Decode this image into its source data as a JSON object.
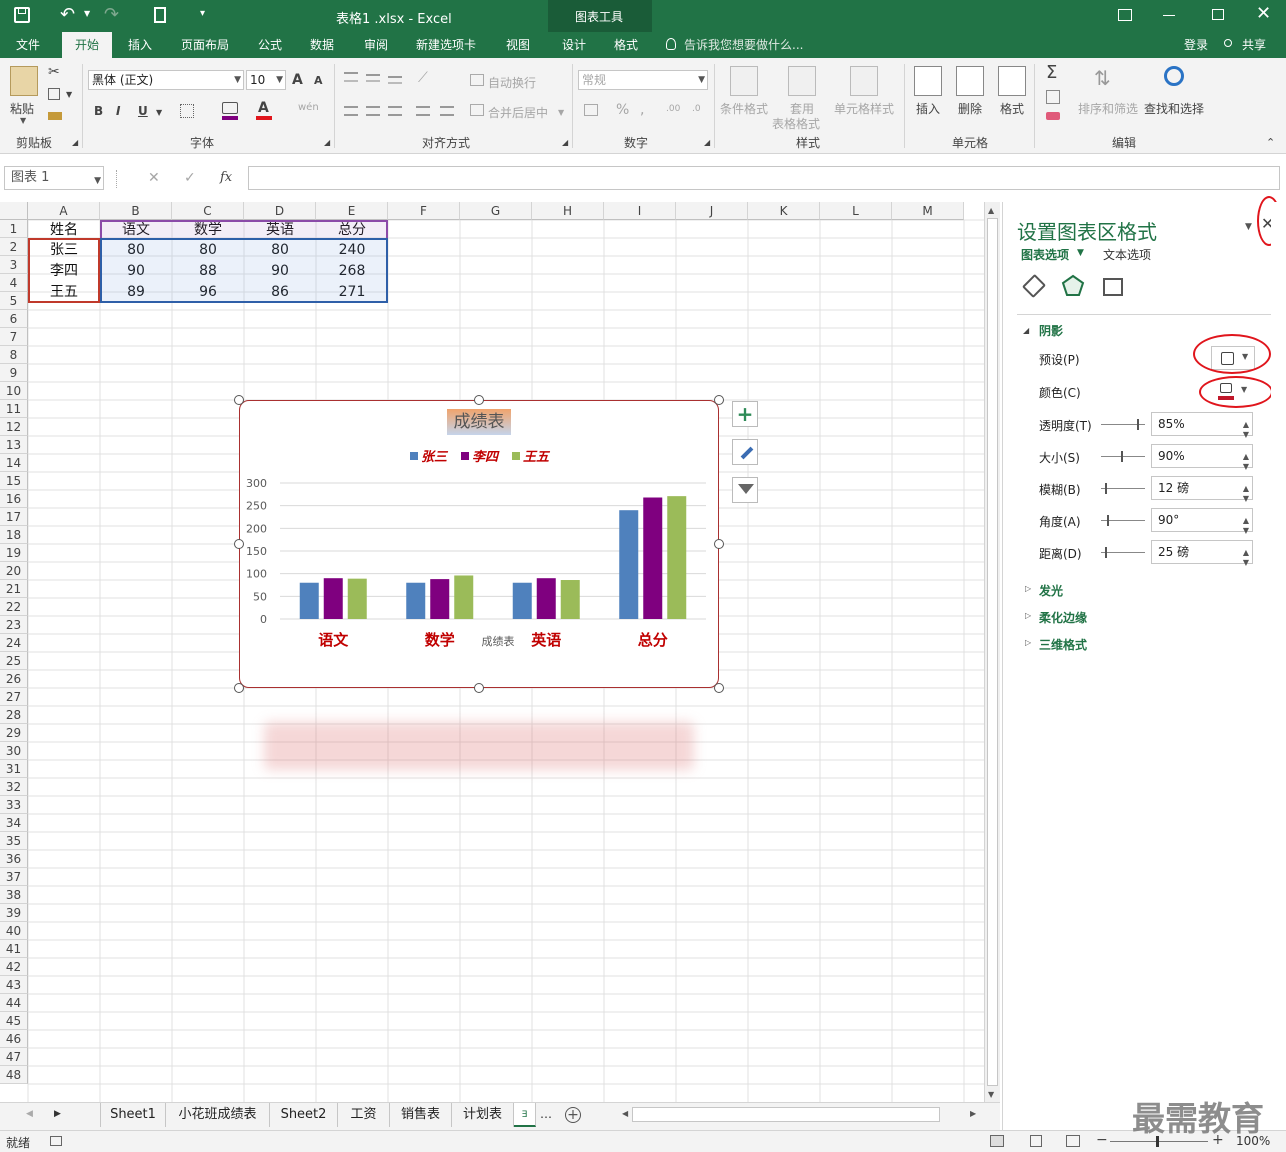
{
  "titlebar": {
    "file_title": "表格1 .xlsx - Excel",
    "context_tools": "图表工具"
  },
  "tabs": {
    "file": "文件",
    "home": "开始",
    "insert": "插入",
    "layout": "页面布局",
    "formulas": "公式",
    "data": "数据",
    "review": "审阅",
    "newtab": "新建选项卡",
    "view": "视图",
    "design": "设计",
    "format": "格式",
    "tellme": "告诉我您想要做什么...",
    "login": "登录",
    "share": "共享"
  },
  "ribbon": {
    "paste": "粘贴",
    "clipboard": "剪贴板",
    "font_name": "黑体 (正文)",
    "font_size": "10",
    "font_group": "字体",
    "wrap": "自动换行",
    "merge": "合并后居中",
    "align_group": "对齐方式",
    "number_format": "常规",
    "number_group": "数字",
    "cond_fmt": "条件格式",
    "table_fmt_1": "套用",
    "table_fmt_2": "表格格式",
    "cell_style": "单元格样式",
    "styles_group": "样式",
    "insert": "插入",
    "delete": "删除",
    "format": "格式",
    "cells_group": "单元格",
    "sort_filter": "排序和筛选",
    "find_select": "查找和选择",
    "edit_group": "编辑",
    "bold": "B",
    "italic": "I",
    "underline": "U",
    "font_inc": "A",
    "font_dec": "A",
    "font_color": "A",
    "wen": "wén"
  },
  "formula_bar": {
    "name_box": "图表 1",
    "cancel": "✕",
    "enter": "✓",
    "fx": "fx",
    "content": ""
  },
  "sheet": {
    "columns": [
      "A",
      "B",
      "C",
      "D",
      "E",
      "F",
      "G",
      "H",
      "I",
      "J",
      "K",
      "L",
      "M"
    ],
    "rows": [
      "1",
      "2",
      "3",
      "4",
      "5",
      "6",
      "7",
      "8",
      "9",
      "10",
      "11",
      "12",
      "13",
      "14",
      "15",
      "16",
      "17",
      "18",
      "19",
      "20",
      "21",
      "22",
      "23",
      "24",
      "25",
      "26",
      "27",
      "28",
      "29",
      "30",
      "31",
      "32",
      "33",
      "34",
      "35",
      "36",
      "37",
      "38",
      "39",
      "40",
      "41",
      "42",
      "43",
      "44",
      "45",
      "46",
      "47",
      "48"
    ],
    "table": [
      [
        "姓名",
        "语文",
        "数学",
        "英语",
        "总分"
      ],
      [
        "张三",
        "80",
        "80",
        "80",
        "240"
      ],
      [
        "李四",
        "90",
        "88",
        "90",
        "268"
      ],
      [
        "王五",
        "89",
        "96",
        "86",
        "271"
      ]
    ]
  },
  "chart_data": {
    "type": "bar",
    "title": "成绩表",
    "xlabel": "成绩表",
    "categories": [
      "语文",
      "数学",
      "英语",
      "总分"
    ],
    "series": [
      {
        "name": "张三",
        "values": [
          80,
          80,
          80,
          240
        ],
        "color": "#4f81bd"
      },
      {
        "name": "李四",
        "values": [
          90,
          88,
          90,
          268
        ],
        "color": "#7f007f"
      },
      {
        "name": "王五",
        "values": [
          89,
          96,
          86,
          271
        ],
        "color": "#9bbb59"
      }
    ],
    "yticks": [
      "300",
      "250",
      "200",
      "150",
      "100",
      "50",
      "0"
    ],
    "ylim": [
      0,
      300
    ],
    "legend": "top",
    "grid": true
  },
  "format_pane": {
    "title": "设置图表区格式",
    "tab_chart_opts": "图表选项",
    "tab_text_opts": "文本选项",
    "section_shadow": "阴影",
    "preset": "预设(P)",
    "color": "颜色(C)",
    "transparency": "透明度(T)",
    "transparency_val": "85%",
    "size": "大小(S)",
    "size_val": "90%",
    "blur": "模糊(B)",
    "blur_val": "12 磅",
    "angle": "角度(A)",
    "angle_val": "90°",
    "distance": "距离(D)",
    "distance_val": "25 磅",
    "section_glow": "发光",
    "section_soft": "柔化边缘",
    "section_3d": "三维格式"
  },
  "sheet_tabs": [
    "Sheet1",
    "小花班成绩表",
    "Sheet2",
    "工资",
    "销售表",
    "计划表",
    "∃"
  ],
  "status": {
    "ready": "就绪",
    "zoom": "100%"
  },
  "watermark": "最需教育",
  "colors": {
    "excel_green": "#217346",
    "accent_red": "#e0151c"
  }
}
